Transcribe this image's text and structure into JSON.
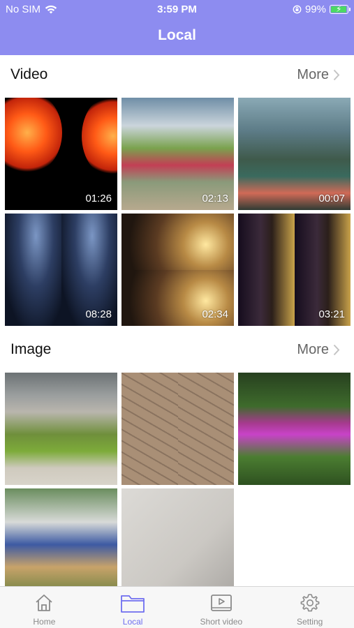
{
  "status_bar": {
    "carrier": "No SIM",
    "time": "3:59 PM",
    "battery_percent": "99%",
    "battery_level": 0.99,
    "battery_color": "#4cd964"
  },
  "nav": {
    "title": "Local",
    "background": "#8d8cf0"
  },
  "video_section": {
    "title": "Video",
    "more_label": "More",
    "items": [
      {
        "duration": "01:26"
      },
      {
        "duration": "02:13"
      },
      {
        "duration": "00:07"
      },
      {
        "duration": "08:28"
      },
      {
        "duration": "02:34"
      },
      {
        "duration": "03:21"
      }
    ]
  },
  "image_section": {
    "title": "Image",
    "more_label": "More",
    "item_count": 5
  },
  "tabbar": {
    "active_color": "#6f6ef0",
    "tabs": [
      {
        "label": "Home",
        "icon": "home-icon"
      },
      {
        "label": "Local",
        "icon": "folder-icon",
        "active": true
      },
      {
        "label": "Short video",
        "icon": "video-icon"
      },
      {
        "label": "Setting",
        "icon": "gear-icon"
      }
    ]
  }
}
